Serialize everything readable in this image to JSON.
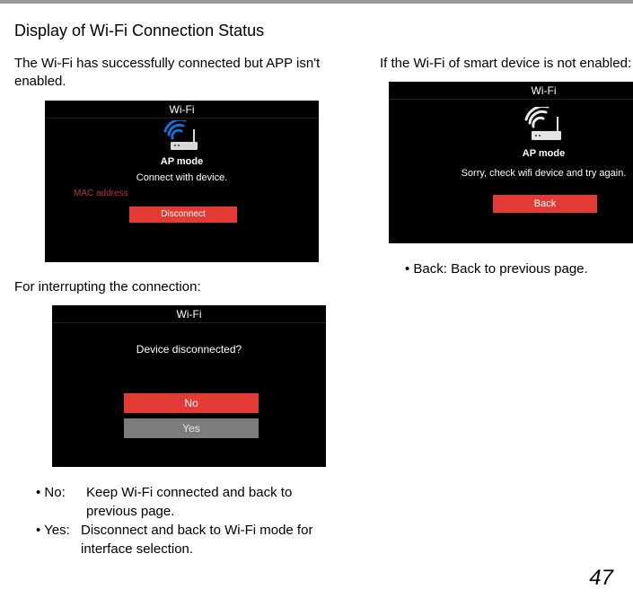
{
  "section_title": "Display of Wi-Fi Connection Status",
  "left": {
    "caption1": "The Wi-Fi has successfully connected but APP isn't enabled.",
    "screen1": {
      "title": "Wi-Fi",
      "ap": "AP mode",
      "line": "Connect with device.",
      "mac": "MAC address",
      "disconnect": "Disconnect"
    },
    "caption2": "For interrupting the connection:",
    "screen2": {
      "title": "Wi-Fi",
      "prompt": "Device disconnected?",
      "no": "No",
      "yes": "Yes"
    },
    "bullet_no_label": "• No:",
    "bullet_no_text": "Keep Wi-Fi connected and back to previous page.",
    "bullet_yes_label": "• Yes:",
    "bullet_yes_text": "Disconnect and back to Wi-Fi mode for interface selection."
  },
  "right": {
    "caption1": "If the Wi-Fi of smart device is not enabled:",
    "screen3": {
      "title": "Wi-Fi",
      "ap": "AP mode",
      "line": "Sorry, check wifi device and try again.",
      "back": "Back"
    },
    "bullet_back": "• Back: Back to previous page."
  },
  "page_num": "47"
}
